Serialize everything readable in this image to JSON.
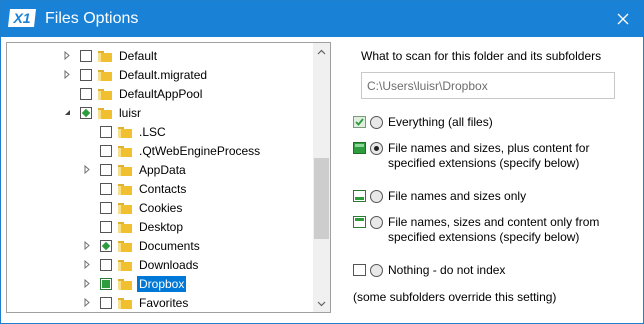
{
  "window": {
    "title": "Files Options",
    "logo_text": "X1"
  },
  "tree": {
    "items": [
      {
        "label": "Default",
        "expander": true,
        "check": "none",
        "selected": false
      },
      {
        "label": "Default.migrated",
        "expander": true,
        "check": "none",
        "selected": false
      },
      {
        "label": "DefaultAppPool",
        "expander": false,
        "check": "none",
        "selected": false
      },
      {
        "label": "luisr",
        "expander": "open",
        "check": "partial",
        "selected": false
      },
      {
        "label": ".LSC",
        "expander": false,
        "check": "none",
        "selected": false
      },
      {
        "label": ".QtWebEngineProcess",
        "expander": false,
        "check": "none",
        "selected": false
      },
      {
        "label": "AppData",
        "expander": true,
        "check": "none",
        "selected": false
      },
      {
        "label": "Contacts",
        "expander": false,
        "check": "none",
        "selected": false
      },
      {
        "label": "Cookies",
        "expander": false,
        "check": "none",
        "selected": false
      },
      {
        "label": "Desktop",
        "expander": false,
        "check": "none",
        "selected": false
      },
      {
        "label": "Documents",
        "expander": true,
        "check": "partial",
        "selected": false
      },
      {
        "label": "Downloads",
        "expander": true,
        "check": "none",
        "selected": false
      },
      {
        "label": "Dropbox",
        "expander": true,
        "check": "full",
        "selected": true
      },
      {
        "label": "Favorites",
        "expander": true,
        "check": "none",
        "selected": false
      }
    ]
  },
  "options": {
    "heading": "What to scan for this folder and its subfolders",
    "path_value": "C:\\Users\\luisr\\Dropbox",
    "choices": [
      {
        "label": "Everything (all files)",
        "icon": "all-files-icon",
        "checked": false
      },
      {
        "label": "File names and sizes, plus content for specified extensions (specify below)",
        "icon": "names-sizes-content-icon",
        "checked": true
      },
      {
        "label": "File names and sizes only",
        "icon": "names-sizes-icon",
        "checked": false
      },
      {
        "label": "File names, sizes and content only from specified extensions (specify below)",
        "icon": "names-sizes-specified-icon",
        "checked": false
      },
      {
        "label": "Nothing - do not index",
        "icon": "nothing-icon",
        "checked": false
      }
    ],
    "note": "(some subfolders override this setting)"
  },
  "colors": {
    "title_bar": "#1a82d6",
    "selection": "#0078d7",
    "check_green": "#2c9c3c",
    "folder_yellow": "#f0c030"
  }
}
